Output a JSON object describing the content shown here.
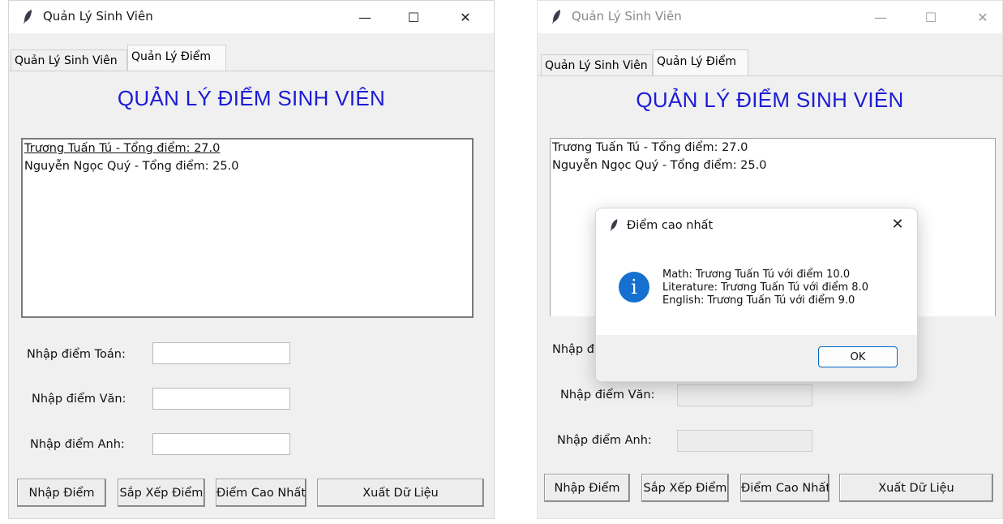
{
  "window_title": "Quản Lý Sinh Viên",
  "controls": {
    "minimize": "—",
    "maximize": "☐",
    "close": "✕"
  },
  "tabs": [
    "Quản Lý Sinh Viên",
    "Quản Lý Điểm"
  ],
  "heading": "QUẢN LÝ ĐIỂM SINH VIÊN",
  "list_items": [
    "Trương Tuấn Tú - Tổng điểm: 27.0",
    "Nguyễn Ngọc Quý - Tổng điểm: 25.0"
  ],
  "fields": {
    "math_label": "Nhập điểm Toán:",
    "lit_label": "Nhập điểm Văn:",
    "eng_label": "Nhập điểm Anh:",
    "math_label_partial": "Nhập đ"
  },
  "buttons": {
    "enter": "Nhập Điểm",
    "sort": "Sắp Xếp Điểm",
    "highest": "Điểm Cao Nhất",
    "export": "Xuất Dữ Liệu"
  },
  "dialog": {
    "title": "Điểm cao nhất",
    "close": "✕",
    "icon": "i",
    "lines": [
      "Math: Trương Tuấn Tú với điểm 10.0",
      "Literature: Trương Tuấn Tú với điểm 8.0",
      "English: Trương Tuấn Tú với điểm 9.0"
    ],
    "ok": "OK"
  }
}
